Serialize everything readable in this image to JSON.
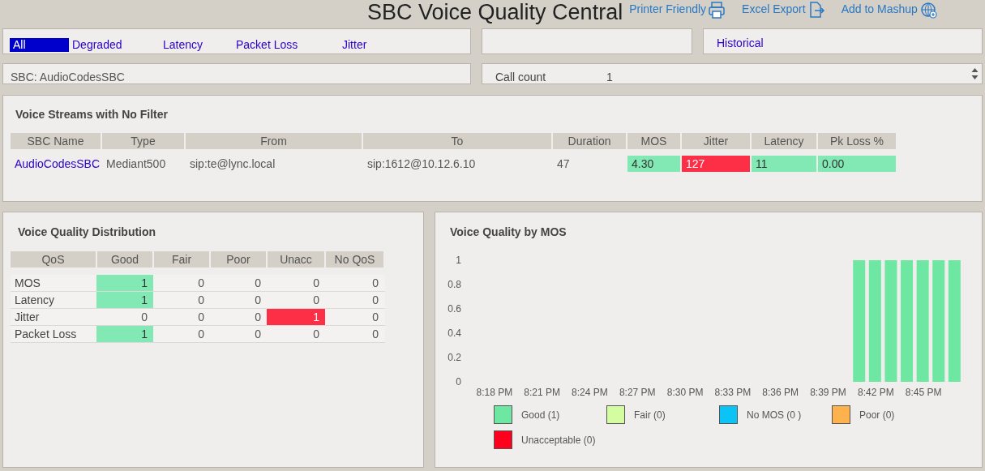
{
  "header": {
    "title": "SBC Voice Quality Central",
    "links": [
      "Printer Friendly",
      "Excel Export",
      "Add to Mashup"
    ]
  },
  "filter_tabs": [
    {
      "label": "All",
      "selected": true
    },
    {
      "label": "Degraded",
      "selected": false
    },
    {
      "label": "Latency",
      "selected": false
    },
    {
      "label": "Packet Loss",
      "selected": false
    },
    {
      "label": "Jitter",
      "selected": false
    }
  ],
  "historical_link": "Historical",
  "sbc_filter": "SBC: AudioCodesSBC",
  "call_count": {
    "label": "Call count",
    "value": "1"
  },
  "streams": {
    "title": "Voice Streams with No Filter",
    "columns": [
      "SBC Name",
      "Type",
      "From",
      "To",
      "Duration",
      "MOS",
      "Jitter",
      "Latency",
      "Pk Loss %"
    ],
    "rows": [
      {
        "cells": [
          {
            "text": "AudioCodesSBC",
            "kind": "link"
          },
          {
            "text": "Mediant500",
            "kind": "plain"
          },
          {
            "text": "sip:te@lync.local",
            "kind": "plain"
          },
          {
            "text": "sip:1612@10.12.6.10",
            "kind": "plain"
          },
          {
            "text": "47",
            "kind": "plain"
          },
          {
            "text": "4.30",
            "kind": "good"
          },
          {
            "text": "127",
            "kind": "bad"
          },
          {
            "text": "11",
            "kind": "good"
          },
          {
            "text": "0.00",
            "kind": "good"
          }
        ]
      }
    ]
  },
  "distribution": {
    "title": "Voice Quality Distribution",
    "columns": [
      "QoS",
      "Good",
      "Fair",
      "Poor",
      "Unacc",
      "No QoS"
    ],
    "rows": [
      {
        "label": "MOS",
        "cells": [
          {
            "text": "1",
            "kind": "good"
          },
          {
            "text": "0",
            "kind": "plain"
          },
          {
            "text": "0",
            "kind": "plain"
          },
          {
            "text": "0",
            "kind": "plain"
          },
          {
            "text": "0",
            "kind": "plain"
          }
        ]
      },
      {
        "label": "Latency",
        "cells": [
          {
            "text": "1",
            "kind": "good"
          },
          {
            "text": "0",
            "kind": "plain"
          },
          {
            "text": "0",
            "kind": "plain"
          },
          {
            "text": "0",
            "kind": "plain"
          },
          {
            "text": "0",
            "kind": "plain"
          }
        ]
      },
      {
        "label": "Jitter",
        "cells": [
          {
            "text": "0",
            "kind": "plain"
          },
          {
            "text": "0",
            "kind": "plain"
          },
          {
            "text": "0",
            "kind": "plain"
          },
          {
            "text": "1",
            "kind": "bad"
          },
          {
            "text": "0",
            "kind": "plain"
          }
        ]
      },
      {
        "label": "Packet Loss",
        "cells": [
          {
            "text": "1",
            "kind": "good"
          },
          {
            "text": "0",
            "kind": "plain"
          },
          {
            "text": "0",
            "kind": "plain"
          },
          {
            "text": "0",
            "kind": "plain"
          },
          {
            "text": "0",
            "kind": "plain"
          }
        ]
      }
    ]
  },
  "mos_chart": {
    "title": "Voice Quality by MOS",
    "chart_data": {
      "type": "bar",
      "stacked": true,
      "categories": [
        "8:18 PM",
        null,
        null,
        "8:21 PM",
        null,
        null,
        "8:24 PM",
        null,
        null,
        "8:27 PM",
        null,
        null,
        "8:30 PM",
        null,
        null,
        "8:33 PM",
        null,
        null,
        "8:36 PM",
        null,
        null,
        "8:39 PM",
        null,
        null,
        "8:42 PM",
        null,
        null,
        "8:45 PM",
        null,
        null
      ],
      "series": [
        {
          "name": "Good (1)",
          "color": "#6ee7a3",
          "values": [
            null,
            null,
            null,
            null,
            null,
            null,
            null,
            null,
            null,
            null,
            null,
            null,
            null,
            null,
            null,
            null,
            null,
            null,
            null,
            null,
            null,
            null,
            null,
            1,
            1,
            1,
            1,
            1,
            1,
            1
          ]
        },
        {
          "name": "Fair (0)",
          "color": "#d4fca0",
          "values": [
            null,
            null,
            null,
            null,
            null,
            null,
            null,
            null,
            null,
            null,
            null,
            null,
            null,
            null,
            null,
            null,
            null,
            null,
            null,
            null,
            null,
            null,
            null,
            null,
            null,
            null,
            null,
            null,
            null,
            null
          ]
        },
        {
          "name": "No MOS (0 )",
          "color": "#0bc3f5",
          "values": [
            null,
            null,
            null,
            null,
            null,
            null,
            null,
            null,
            null,
            null,
            null,
            null,
            null,
            null,
            null,
            null,
            null,
            null,
            null,
            null,
            null,
            null,
            null,
            null,
            null,
            null,
            null,
            null,
            null,
            null
          ]
        },
        {
          "name": "Poor (0)",
          "color": "#fdb24e",
          "values": [
            null,
            null,
            null,
            null,
            null,
            null,
            null,
            null,
            null,
            null,
            null,
            null,
            null,
            null,
            null,
            null,
            null,
            null,
            null,
            null,
            null,
            null,
            null,
            null,
            null,
            null,
            null,
            null,
            null,
            null
          ]
        },
        {
          "name": "Unacceptable (0)",
          "color": "#fc001e",
          "values": [
            null,
            null,
            null,
            null,
            null,
            null,
            null,
            null,
            null,
            null,
            null,
            null,
            null,
            null,
            null,
            null,
            null,
            null,
            null,
            null,
            null,
            null,
            null,
            null,
            null,
            null,
            null,
            null,
            null,
            null
          ]
        }
      ],
      "ylim": [
        0,
        1
      ],
      "yticks": [
        0,
        0.2,
        0.4,
        0.6,
        0.8,
        1
      ]
    }
  }
}
